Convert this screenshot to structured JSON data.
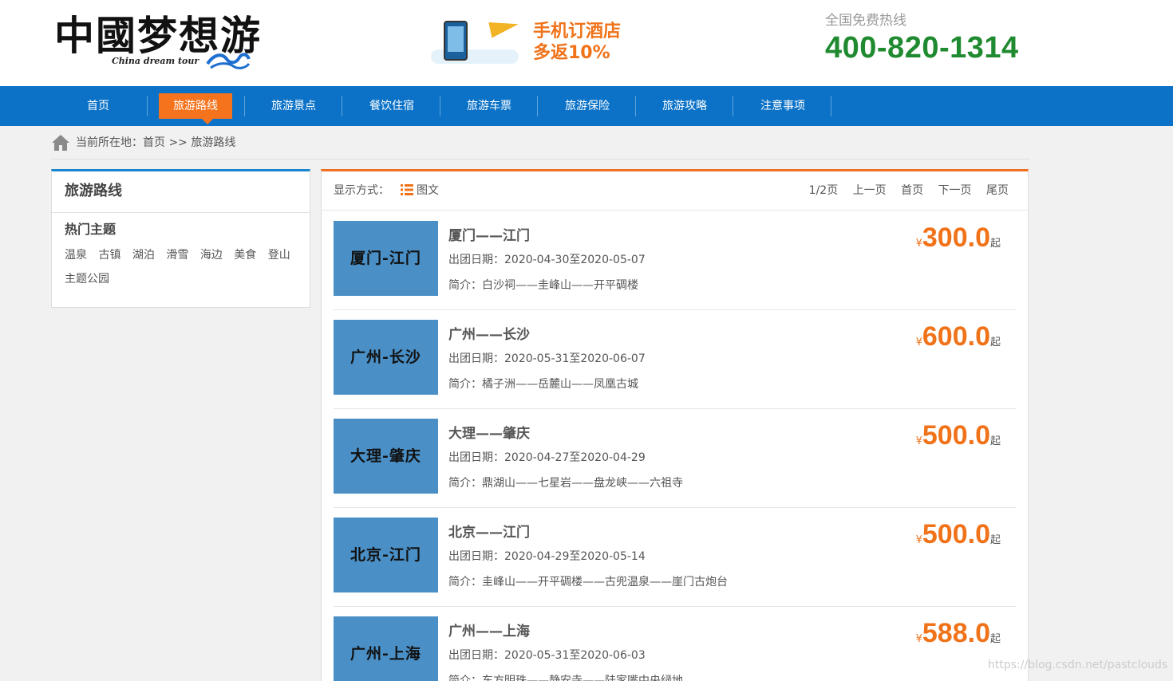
{
  "header": {
    "logo_text": "中國梦想游",
    "logo_subtitle": "China dream tour",
    "promo_line1": "手机订酒店",
    "promo_line2": "多返10%",
    "hotline_label": "全国免费热线",
    "hotline_number": "400-820-1314"
  },
  "nav": {
    "items": [
      "首页",
      "旅游路线",
      "旅游景点",
      "餐饮住宿",
      "旅游车票",
      "旅游保险",
      "旅游攻略",
      "注意事项"
    ],
    "active": "旅游路线"
  },
  "breadcrumb": {
    "text": "当前所在地：首页 >> 旅游路线"
  },
  "sidebar": {
    "title": "旅游路线",
    "subtitle": "热门主题",
    "tags": [
      "温泉",
      "古镇",
      "湖泊",
      "滑雪",
      "海边",
      "美食",
      "登山",
      "主题公园"
    ]
  },
  "toolbar": {
    "view_label": "显示方式：",
    "view_mode": "图文",
    "page_info": "1/2页",
    "prev": "上一页",
    "first": "首页",
    "next": "下一页",
    "last": "尾页"
  },
  "routes": [
    {
      "thumb": "厦门-江门",
      "title": "厦门——江门",
      "date": "出团日期：2020-04-30至2020-05-07",
      "intro": "简介：白沙祠——圭峰山——开平碉楼",
      "currency": "¥",
      "price": "300.0",
      "suffix": "起"
    },
    {
      "thumb": "广州-长沙",
      "title": "广州——长沙",
      "date": "出团日期：2020-05-31至2020-06-07",
      "intro": "简介：橘子洲——岳麓山——凤凰古城",
      "currency": "¥",
      "price": "600.0",
      "suffix": "起"
    },
    {
      "thumb": "大理-肇庆",
      "title": "大理——肇庆",
      "date": "出团日期：2020-04-27至2020-04-29",
      "intro": "简介：鼎湖山——七星岩——盘龙峡——六祖寺",
      "currency": "¥",
      "price": "500.0",
      "suffix": "起"
    },
    {
      "thumb": "北京-江门",
      "title": "北京——江门",
      "date": "出团日期：2020-04-29至2020-05-14",
      "intro": "简介：圭峰山——开平碉楼——古兜温泉——崖门古炮台",
      "currency": "¥",
      "price": "500.0",
      "suffix": "起"
    },
    {
      "thumb": "广州-上海",
      "title": "广州——上海",
      "date": "出团日期：2020-05-31至2020-06-03",
      "intro": "简介：东方明珠——静安寺——陆家嘴中央绿地",
      "currency": "¥",
      "price": "588.0",
      "suffix": "起"
    }
  ],
  "watermark": "https://blog.csdn.net/pastclouds",
  "colors": {
    "nav_blue": "#0b72c7",
    "accent_orange": "#f5731c",
    "hotline_green": "#1f8a2f",
    "thumb_blue": "#4a8fc6"
  }
}
